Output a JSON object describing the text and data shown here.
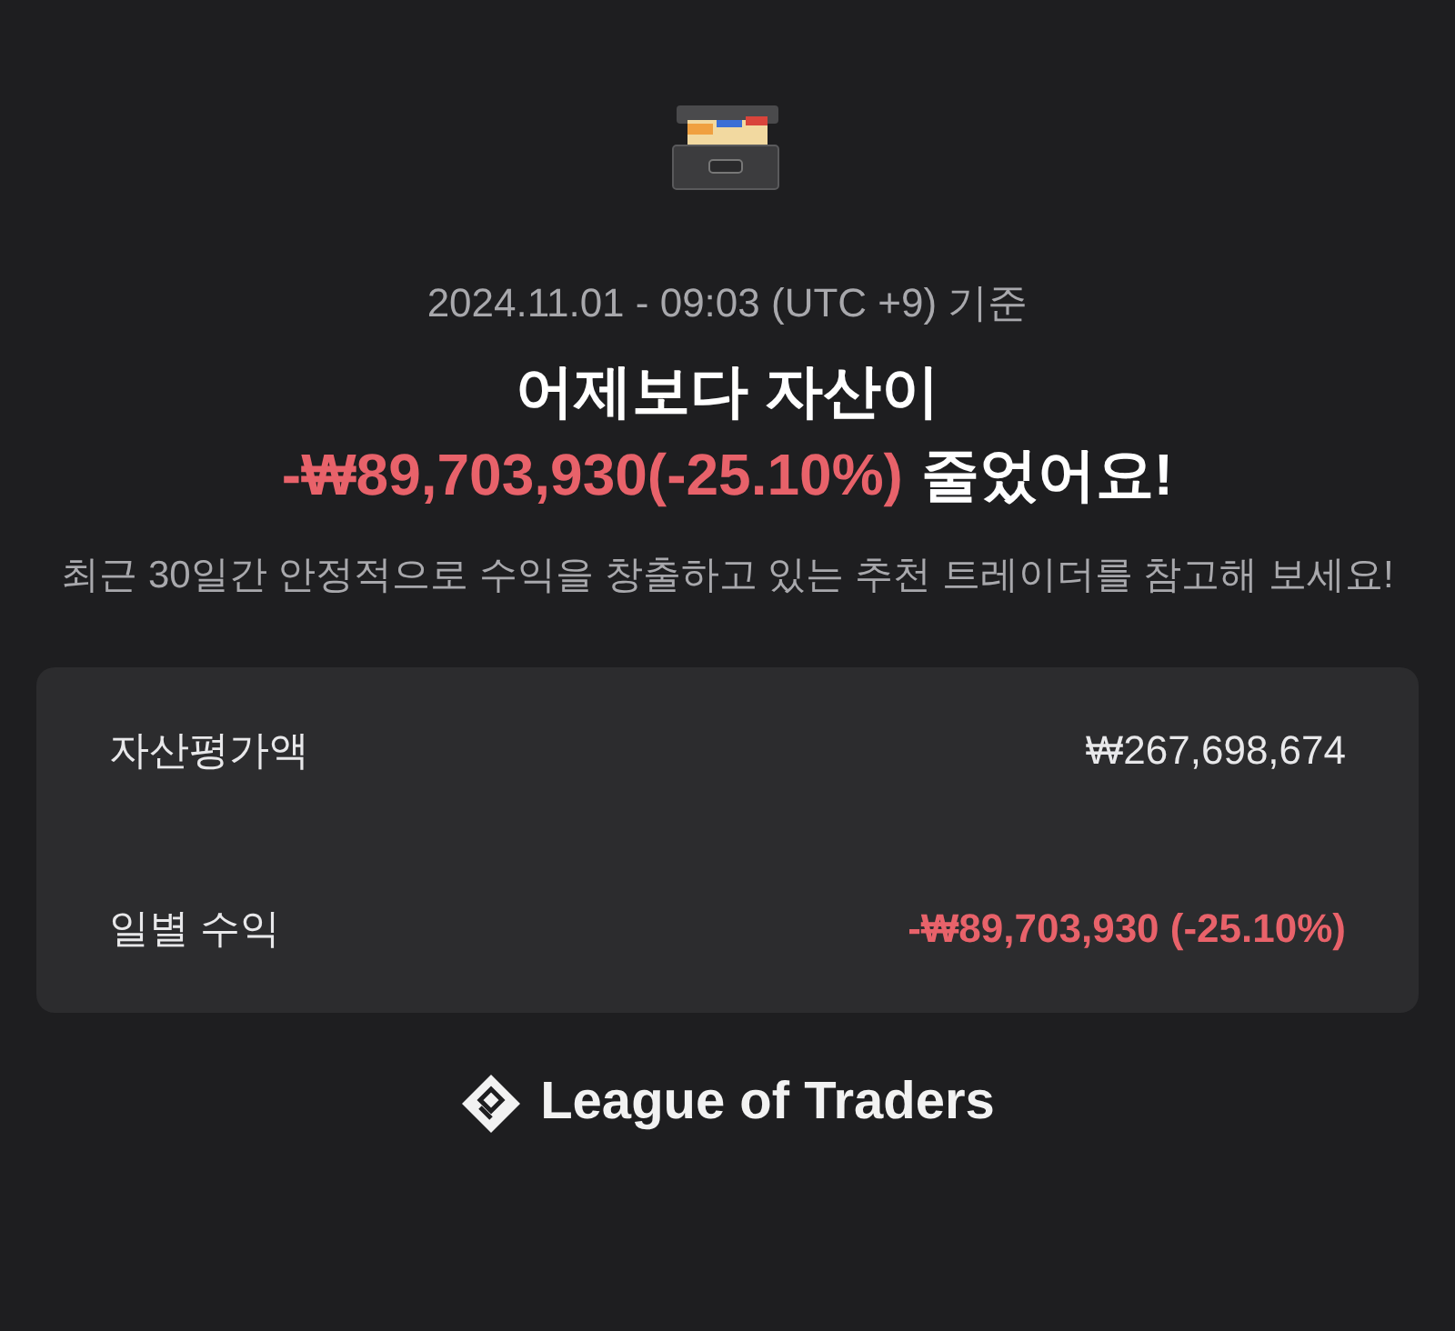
{
  "timestamp": "2024.11.01 - 09:03 (UTC +9) 기준",
  "headline": {
    "line1": "어제보다 자산이",
    "change": "-₩89,703,930(-25.10%)",
    "suffix": "줄었어요!"
  },
  "message": "최근 30일간 안정적으로 수익을 창출하고 있는 추천 트레이더를 참고해 보세요!",
  "summary": [
    {
      "label": "자산평가액",
      "value": "₩267,698,674",
      "negative": false
    },
    {
      "label": "일별 수익",
      "value": "-₩89,703,930 (-25.10%)",
      "negative": true
    }
  ],
  "brand": "League of Traders"
}
